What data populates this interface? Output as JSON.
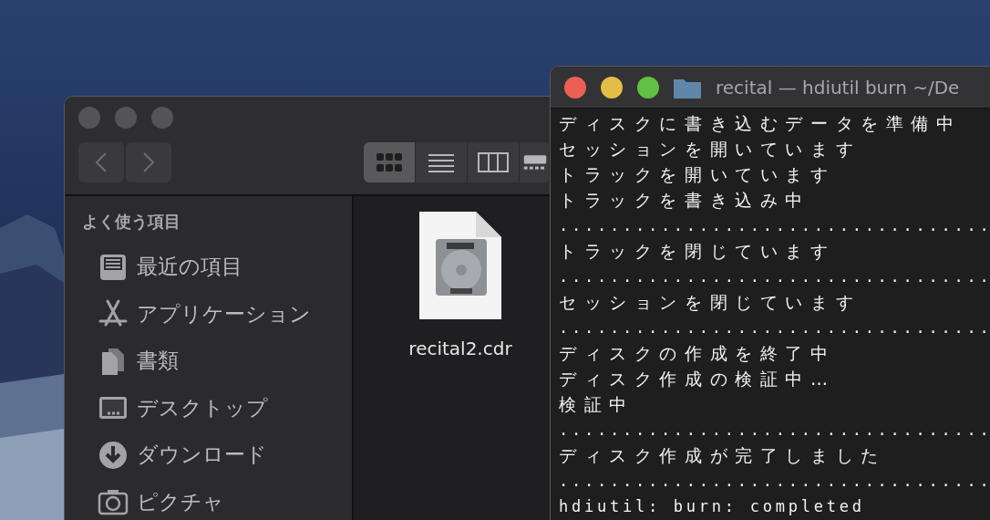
{
  "finder": {
    "views": [
      {
        "kind": "icons",
        "selected": true
      },
      {
        "kind": "list",
        "selected": false
      },
      {
        "kind": "columns",
        "selected": false
      },
      {
        "kind": "gallery",
        "selected": false
      }
    ],
    "sidebar": {
      "heading": "よく使う項目",
      "items": [
        {
          "kind": "recents",
          "label": "最近の項目"
        },
        {
          "kind": "applications",
          "label": "アプリケーション"
        },
        {
          "kind": "documents",
          "label": "書類"
        },
        {
          "kind": "desktop",
          "label": "デスクトップ"
        },
        {
          "kind": "downloads",
          "label": "ダウンロード"
        },
        {
          "kind": "pictures",
          "label": "ピクチャ"
        }
      ]
    },
    "files": [
      {
        "name": "recital2.cdr"
      }
    ]
  },
  "terminal": {
    "title": "recital — hdiutil burn ~/De",
    "lines": [
      {
        "kind": "message",
        "text": "ディスクに書き込むデータを準備中"
      },
      {
        "kind": "message",
        "text": "セッションを開いています"
      },
      {
        "kind": "message",
        "text": "トラックを開いています"
      },
      {
        "kind": "message",
        "text": "トラックを書き込み中"
      },
      {
        "kind": "progress",
        "text": ".................................."
      },
      {
        "kind": "message",
        "text": "トラックを閉じています"
      },
      {
        "kind": "progress",
        "text": ".................................."
      },
      {
        "kind": "message",
        "text": "セッションを閉じています"
      },
      {
        "kind": "progress",
        "text": ".................................."
      },
      {
        "kind": "message",
        "text": "ディスクの作成を終了中"
      },
      {
        "kind": "message",
        "text": "ディスク作成の検証中…"
      },
      {
        "kind": "message",
        "text": "検証中"
      },
      {
        "kind": "progress",
        "text": ".................................."
      },
      {
        "kind": "message",
        "text": "ディスク作成が完了しました"
      },
      {
        "kind": "progress",
        "text": ".................................."
      },
      {
        "kind": "result",
        "text": "hdiutil: burn: completed"
      }
    ]
  }
}
